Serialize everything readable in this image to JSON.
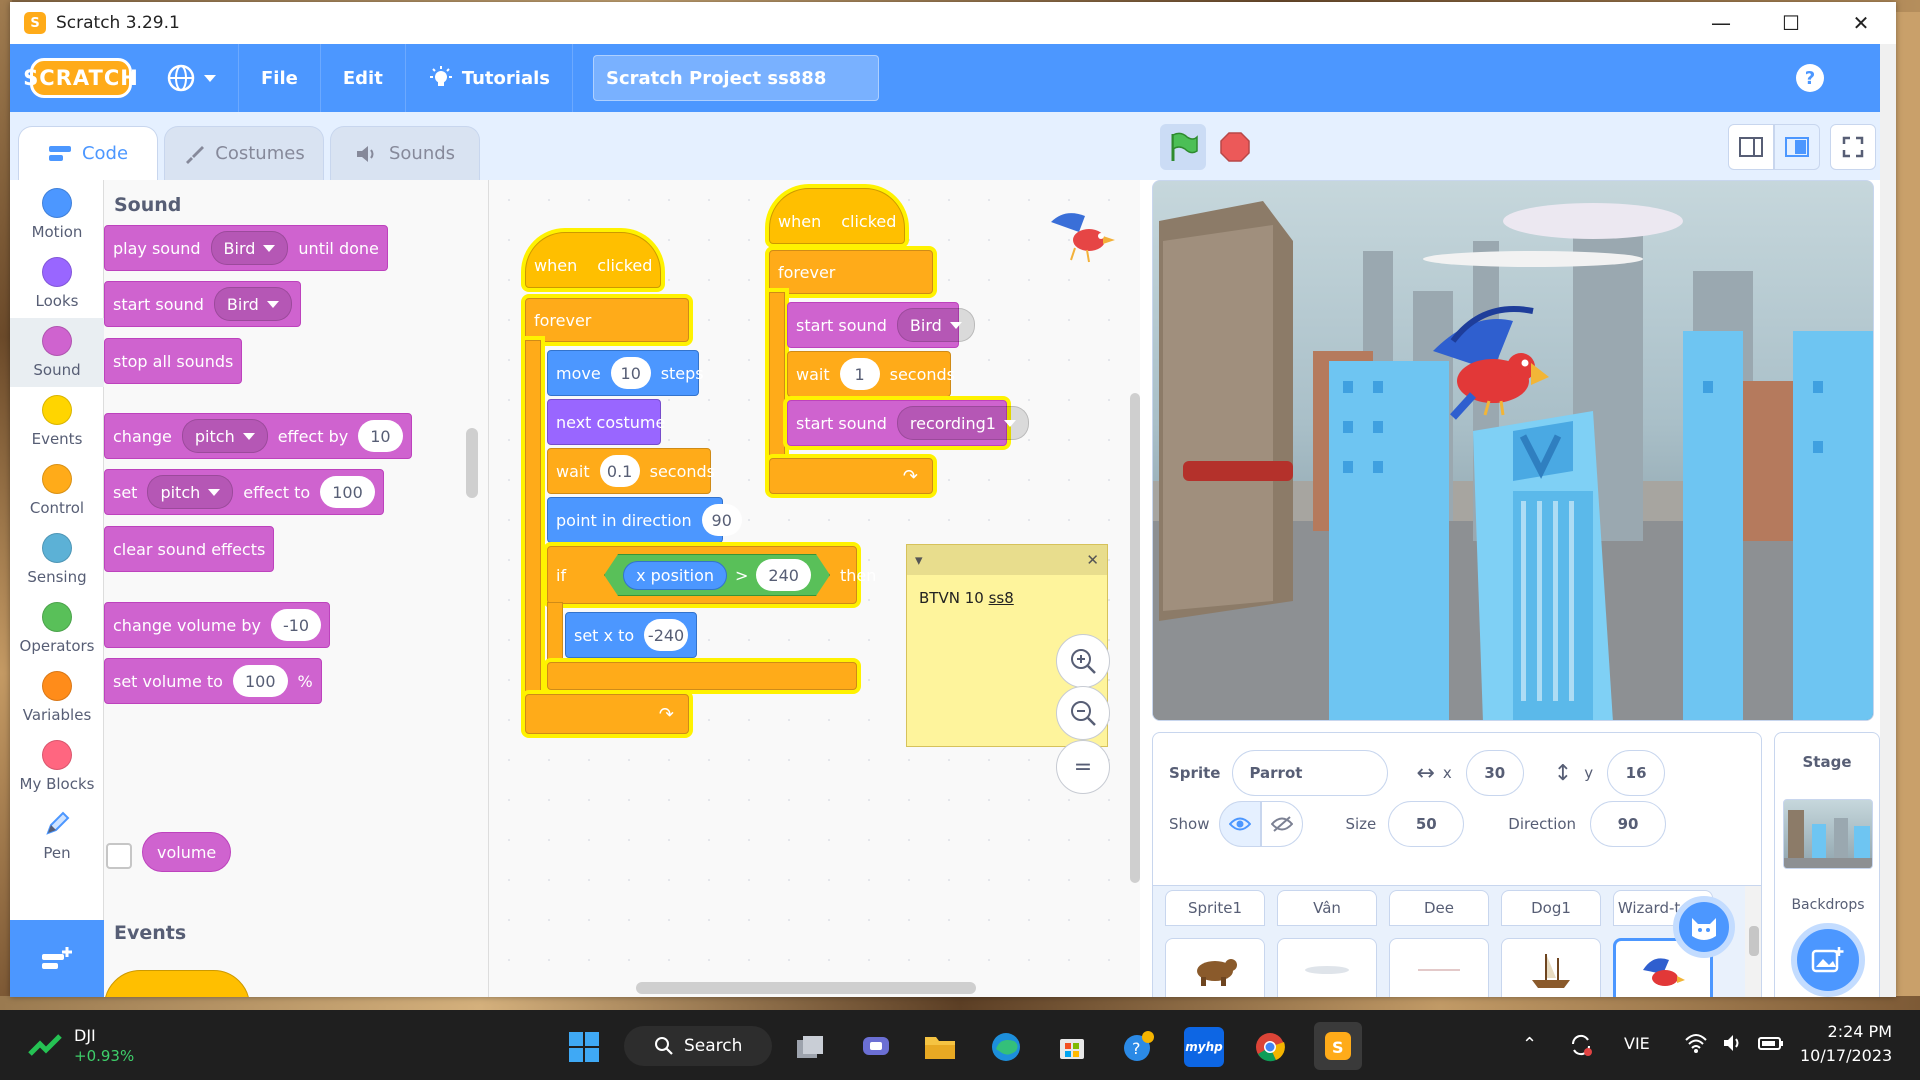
{
  "window": {
    "title": "Scratch 3.29.1"
  },
  "menubar": {
    "logo": "SCRATCH",
    "file": "File",
    "edit": "Edit",
    "tutorials": "Tutorials",
    "project_title": "Scratch Project ss888",
    "help": "?"
  },
  "tabs": {
    "code": "Code",
    "costumes": "Costumes",
    "sounds": "Sounds"
  },
  "categories": [
    {
      "label": "Motion",
      "color": "#4c97ff"
    },
    {
      "label": "Looks",
      "color": "#9966ff"
    },
    {
      "label": "Sound",
      "color": "#cf63cf"
    },
    {
      "label": "Events",
      "color": "#ffd500"
    },
    {
      "label": "Control",
      "color": "#ffab19"
    },
    {
      "label": "Sensing",
      "color": "#5cb1d6"
    },
    {
      "label": "Operators",
      "color": "#59c059"
    },
    {
      "label": "Variables",
      "color": "#ff8c1a"
    },
    {
      "label": "My Blocks",
      "color": "#ff6680"
    },
    {
      "label": "Pen",
      "color": ""
    }
  ],
  "palette": {
    "heading": "Sound",
    "heading2": "Events",
    "play_sound": {
      "a": "play sound",
      "menu": "Bird",
      "b": "until done"
    },
    "start_sound": {
      "a": "start sound",
      "menu": "Bird"
    },
    "stop_all": "stop all sounds",
    "change_effect": {
      "a": "change",
      "menu": "pitch",
      "b": "effect by",
      "val": "10"
    },
    "set_effect": {
      "a": "set",
      "menu": "pitch",
      "b": "effect to",
      "val": "100"
    },
    "clear_effects": "clear sound effects",
    "change_volume": {
      "a": "change volume by",
      "val": "-10"
    },
    "set_volume": {
      "a": "set volume to",
      "val": "100",
      "b": "%"
    },
    "volume": "volume"
  },
  "script1": {
    "when": "when",
    "clicked": "clicked",
    "forever": "forever",
    "move": {
      "a": "move",
      "val": "10",
      "b": "steps"
    },
    "next_costume": "next costume",
    "wait": {
      "a": "wait",
      "val": "0.1",
      "b": "seconds"
    },
    "point": {
      "a": "point in direction",
      "val": "90"
    },
    "if_word": "if",
    "xpos": "x position",
    "gt": ">",
    "gt_val": "240",
    "then": "then",
    "setx": {
      "a": "set x to",
      "val": "-240"
    }
  },
  "script2": {
    "when": "when",
    "clicked": "clicked",
    "forever": "forever",
    "start1": {
      "a": "start sound",
      "menu": "Bird"
    },
    "wait": {
      "a": "wait",
      "val": "1",
      "b": "seconds"
    },
    "start2": {
      "a": "start sound",
      "menu": "recording1"
    }
  },
  "note": {
    "text_a": "BTVN 10 ",
    "text_b": "ss8"
  },
  "zoom": {
    "in": "+",
    "out": "−",
    "reset": "="
  },
  "sprite_info": {
    "sprite_label": "Sprite",
    "sprite_name": "Parrot",
    "x_label": "x",
    "x": "30",
    "y_label": "y",
    "y": "16",
    "show_label": "Show",
    "size_label": "Size",
    "size": "50",
    "direction_label": "Direction",
    "direction": "90"
  },
  "sprites": [
    "Sprite1",
    "Vân",
    "Dee",
    "Dog1",
    "Wizard-toad"
  ],
  "stage_pane": {
    "label": "Stage",
    "backdrops": "Backdrops"
  },
  "taskbar": {
    "stock_name": "DJI",
    "stock_change": "+0.93%",
    "search": "Search",
    "lang": "VIE",
    "time": "2:24 PM",
    "date": "10/17/2023"
  }
}
